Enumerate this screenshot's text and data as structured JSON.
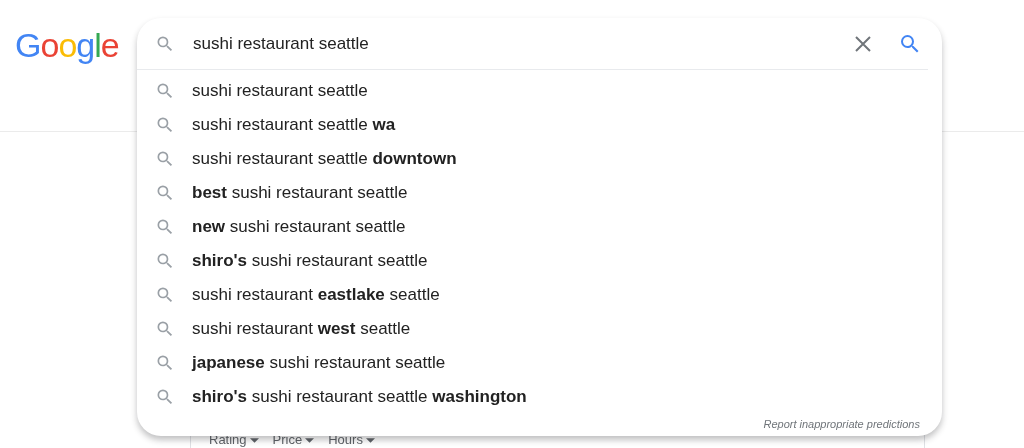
{
  "logo": {
    "text": "Google"
  },
  "search": {
    "value": "sushi restaurant seattle"
  },
  "suggestions": [
    {
      "text": "sushi restaurant seattle"
    },
    {
      "text": "sushi restaurant seattle **wa**"
    },
    {
      "text": "sushi restaurant seattle **downtown**"
    },
    {
      "text": "**best** sushi restaurant seattle"
    },
    {
      "text": "**new** sushi restaurant seattle"
    },
    {
      "text": "**shiro's** sushi restaurant seattle"
    },
    {
      "text": "sushi restaurant **eastlake** seattle"
    },
    {
      "text": "sushi restaurant **west** seattle"
    },
    {
      "text": "**japanese** sushi restaurant seattle"
    },
    {
      "text": "**shiro's** sushi restaurant seattle **washington**"
    }
  ],
  "report_link": "Report inappropriate predictions",
  "filters": [
    "Rating",
    "Price",
    "Hours"
  ]
}
